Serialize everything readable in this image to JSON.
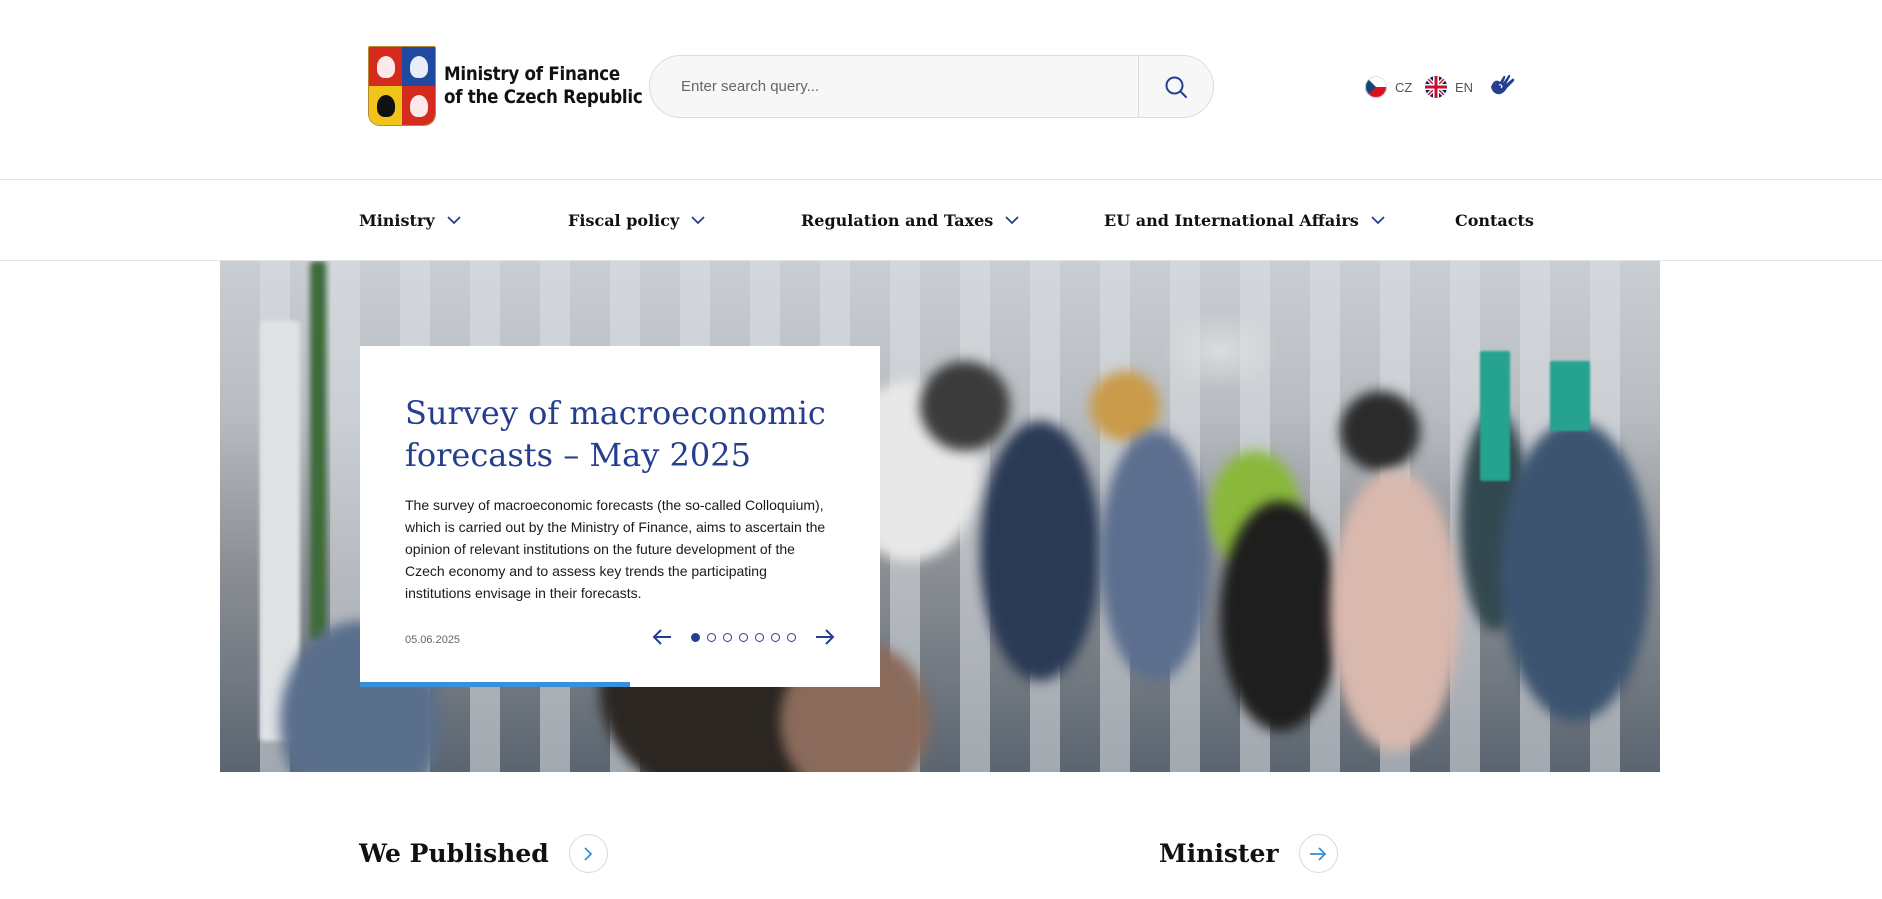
{
  "header": {
    "logo_line1": "Ministry of Finance",
    "logo_line2": "of the Czech Republic",
    "search_placeholder": "Enter search query...",
    "languages": [
      {
        "code": "CZ",
        "icon": "czech-flag-icon"
      },
      {
        "code": "EN",
        "icon": "uk-flag-icon"
      }
    ],
    "sign_language_icon": "sign-language-icon"
  },
  "nav": {
    "items": [
      {
        "label": "Ministry",
        "has_dropdown": true
      },
      {
        "label": "Fiscal policy",
        "has_dropdown": true
      },
      {
        "label": "Regulation and Taxes",
        "has_dropdown": true
      },
      {
        "label": "EU and International Affairs",
        "has_dropdown": true
      },
      {
        "label": "Contacts",
        "has_dropdown": false
      }
    ]
  },
  "hero": {
    "title": "Survey of macroeconomic forecasts – May 2025",
    "description": "The survey of macroeconomic forecasts (the so-called Colloquium), which is carried out by the Ministry of Finance, aims to ascertain the opinion of relevant institutions on the future development of the Czech economy and to assess key trends the participating institutions envisage in their forecasts.",
    "date": "05.06.2025",
    "slide_count": 7,
    "active_slide": 1,
    "progress_fraction": 0.52
  },
  "sections": {
    "published": "We Published",
    "minister": "Minister"
  },
  "colors": {
    "accent_blue": "#243f8f",
    "progress_blue": "#3a8fd9"
  }
}
